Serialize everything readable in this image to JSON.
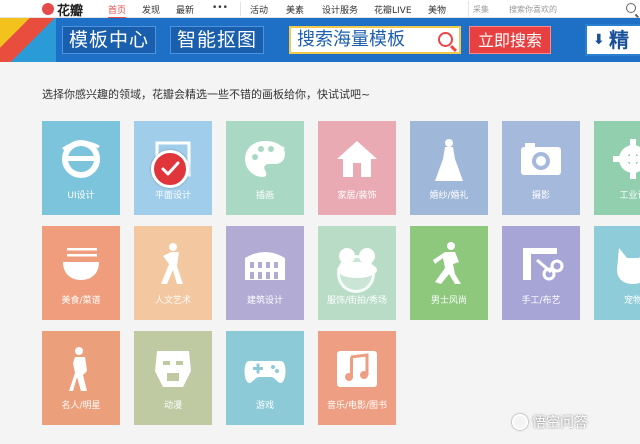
{
  "topnav": {
    "logo_text": "花瓣",
    "items": [
      "首页",
      "发现",
      "最新",
      "•••",
      "活动",
      "美素",
      "设计服务",
      "花瓣LIVE",
      "美物"
    ],
    "search_category": "采集",
    "search_placeholder": "搜索你喜欢的"
  },
  "banner": {
    "chip1": "模板中心",
    "chip2": "智能抠图",
    "search_text": "搜索海量模板",
    "button": "立即搜索",
    "right": "精"
  },
  "intro": "选择你感兴趣的领域，花瓣会精选一些不错的画板给你，快试试吧~",
  "tiles": [
    {
      "label": "UI设计",
      "color": "#7cc4dc",
      "icon": "ie-icon"
    },
    {
      "label": "平面设计",
      "color": "#9fcdea",
      "icon": "ps-icon"
    },
    {
      "label": "插画",
      "color": "#a9d8c4",
      "icon": "palette-icon"
    },
    {
      "label": "家居/装饰",
      "color": "#e9aab3",
      "icon": "house-icon"
    },
    {
      "label": "婚纱/婚礼",
      "color": "#9fb7d9",
      "icon": "bride-icon"
    },
    {
      "label": "摄影",
      "color": "#a5b9dc",
      "icon": "camera-icon"
    },
    {
      "label": "工业设",
      "color": "#92cfae",
      "icon": "gear-icon"
    },
    {
      "label": "美食/菜谱",
      "color": "#ef9d7c",
      "icon": "bowl-icon"
    },
    {
      "label": "人文艺术",
      "color": "#f3c79f",
      "icon": "dancer-icon"
    },
    {
      "label": "建筑设计",
      "color": "#b2acd5",
      "icon": "colosseum-icon"
    },
    {
      "label": "服饰/街拍/秀场",
      "color": "#b8dcc6",
      "icon": "hat-icon"
    },
    {
      "label": "男士风尚",
      "color": "#8dc87d",
      "icon": "runner-icon"
    },
    {
      "label": "手工/布艺",
      "color": "#a7a5d6",
      "icon": "scissors-icon"
    },
    {
      "label": "宠物",
      "color": "#8dccd8",
      "icon": "pet-icon"
    },
    {
      "label": "名人/明星",
      "color": "#ec9f7b",
      "icon": "singer-icon"
    },
    {
      "label": "动漫",
      "color": "#bfc9a2",
      "icon": "robot-icon"
    },
    {
      "label": "游戏",
      "color": "#8ccad8",
      "icon": "gamepad-icon"
    },
    {
      "label": "音乐/电影/图书",
      "color": "#ee9f83",
      "icon": "music-icon"
    }
  ],
  "watermark": "悟空问答"
}
